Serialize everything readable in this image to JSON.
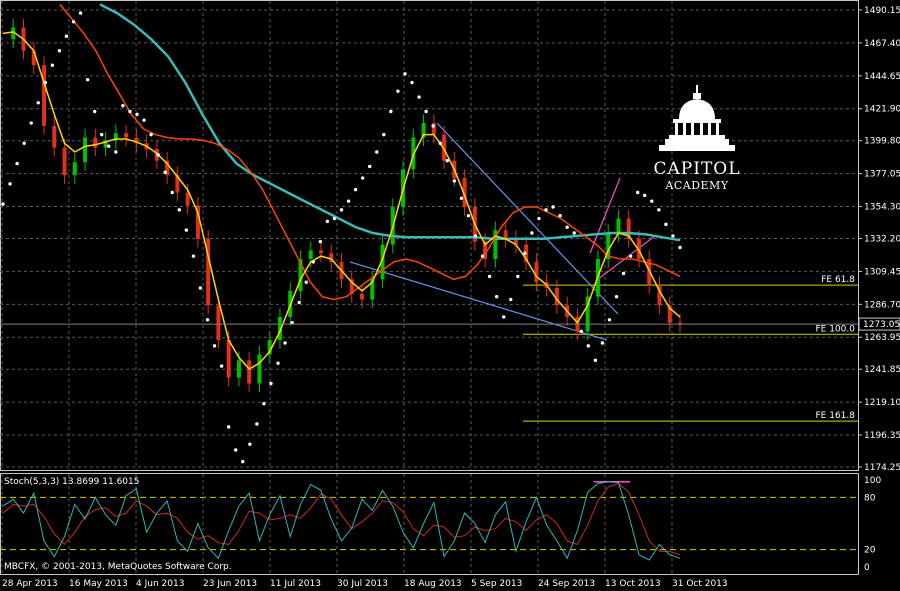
{
  "chart_data": {
    "type": "line",
    "price_panel": {
      "ylim": [
        1174.25,
        1490.15
      ],
      "y_ticks": [
        "1490.15",
        "1467.40",
        "1444.65",
        "1421.90",
        "1399.80",
        "1377.05",
        "1354.30",
        "1332.20",
        "1309.45",
        "1286.70",
        "1263.95",
        "1241.85",
        "1219.10",
        "1196.35",
        "1174.25"
      ],
      "current_price": "1273.05",
      "series": [
        {
          "role": "price_candles",
          "color": "#e0301e",
          "up_color": "#00c000",
          "values": [
            1470,
            1478,
            1462,
            1452,
            1410,
            1395,
            1376,
            1385,
            1402,
            1395,
            1400,
            1405,
            1402,
            1398,
            1394,
            1386,
            1376,
            1364,
            1355,
            1332,
            1286,
            1262,
            1236,
            1248,
            1232,
            1252,
            1262,
            1278,
            1296,
            1318,
            1324,
            1322,
            1316,
            1304,
            1294,
            1290,
            1304,
            1328,
            1354,
            1380,
            1402,
            1412,
            1404,
            1386,
            1374,
            1354,
            1330,
            1318,
            1338,
            1332,
            1328,
            1316,
            1302,
            1298,
            1286,
            1278,
            1268,
            1292,
            1318,
            1336,
            1346,
            1332,
            1318,
            1300,
            1286,
            1274,
            1273
          ]
        },
        {
          "role": "fast_ma",
          "color": "#ffd700",
          "values": [
            1474,
            1475,
            1470,
            1462,
            1440,
            1418,
            1398,
            1392,
            1396,
            1397,
            1399,
            1401,
            1401,
            1399,
            1396,
            1391,
            1384,
            1375,
            1366,
            1350,
            1320,
            1290,
            1262,
            1250,
            1242,
            1246,
            1254,
            1268,
            1286,
            1304,
            1316,
            1320,
            1318,
            1310,
            1302,
            1296,
            1302,
            1318,
            1340,
            1366,
            1390,
            1404,
            1404,
            1394,
            1380,
            1362,
            1342,
            1328,
            1334,
            1332,
            1328,
            1318,
            1306,
            1300,
            1290,
            1282,
            1274,
            1286,
            1306,
            1324,
            1336,
            1334,
            1324,
            1310,
            1296,
            1284,
            1278
          ]
        },
        {
          "role": "mid_ma",
          "color": "#ff4500",
          "values": [
            1494,
            1484,
            1474,
            1462,
            1446,
            1432,
            1418,
            1408,
            1404,
            1402,
            1401,
            1401,
            1400,
            1398,
            1394,
            1388,
            1378,
            1366,
            1350,
            1334,
            1318,
            1302,
            1292,
            1290,
            1292,
            1298,
            1304,
            1310,
            1316,
            1318,
            1316,
            1312,
            1308,
            1304,
            1306,
            1314,
            1326,
            1340,
            1350,
            1354,
            1354,
            1350,
            1346,
            1340,
            1334,
            1328,
            1320,
            1318,
            1318,
            1316,
            1314,
            1310,
            1306
          ]
        },
        {
          "role": "slow_ma",
          "color": "#3cb9b9",
          "values": [
            1494,
            1488,
            1480,
            1470,
            1458,
            1440,
            1418,
            1398,
            1384,
            1376,
            1370,
            1364,
            1358,
            1352,
            1346,
            1340,
            1336,
            1334,
            1333,
            1333,
            1333,
            1333,
            1333,
            1332,
            1332,
            1332,
            1332,
            1333,
            1334,
            1335,
            1336,
            1336,
            1335,
            1333,
            1331
          ]
        },
        {
          "role": "parabolic_sar",
          "color": "#ffffff",
          "values": [
            1356,
            1370,
            1384,
            1398,
            1412,
            1426,
            1440,
            1452,
            1462,
            1472,
            1482,
            1488,
            1442,
            1420,
            1404,
            1396,
            1392,
            1424,
            1420,
            1418,
            1414,
            1404,
            1390,
            1378,
            1364,
            1352,
            1338,
            1320,
            1298,
            1276,
            1258,
            1244,
            1202,
            1186,
            1178,
            1190,
            1204,
            1218,
            1232,
            1246,
            1260,
            1274,
            1288,
            1302,
            1316,
            1330,
            1344,
            1346,
            1352,
            1358,
            1366,
            1374,
            1382,
            1392,
            1404,
            1420,
            1434,
            1446,
            1440,
            1430,
            1420,
            1410,
            1398,
            1386,
            1372,
            1360,
            1348,
            1334,
            1320,
            1306,
            1292,
            1278,
            1290,
            1306,
            1322,
            1336,
            1346,
            1352,
            1354,
            1348,
            1340,
            1336,
            1268,
            1258,
            1248,
            1260,
            1276,
            1292,
            1308,
            1320,
            1364,
            1362,
            1358,
            1352,
            1342,
            1334,
            1326
          ]
        }
      ],
      "fibonacci_levels": [
        {
          "label": "FE 61.8",
          "value": 1300
        },
        {
          "label": "FE 100.0",
          "value": 1266
        },
        {
          "label": "FE 161.8",
          "value": 1206
        }
      ]
    },
    "stochastic_panel": {
      "label": "Stoch(5,3,3) 13.8699 11.6015",
      "ylim": [
        0,
        100
      ],
      "y_ticks": [
        "100",
        "80",
        "20",
        "0"
      ],
      "levels": [
        80,
        20
      ],
      "series": [
        {
          "role": "k",
          "color": "#2fb5b5",
          "values": [
            70,
            78,
            62,
            85,
            30,
            12,
            35,
            72,
            55,
            80,
            60,
            48,
            82,
            90,
            40,
            62,
            76,
            30,
            18,
            50,
            22,
            10,
            42,
            70,
            85,
            30,
            60,
            82,
            35,
            72,
            95,
            88,
            55,
            30,
            45,
            78,
            65,
            88,
            70,
            40,
            22,
            50,
            74,
            12,
            30,
            62,
            50,
            28,
            60,
            75,
            18,
            52,
            80,
            48,
            30,
            10,
            42,
            86,
            96,
            98,
            97,
            60,
            14,
            8,
            26,
            14,
            10
          ]
        },
        {
          "role": "d",
          "color": "#cc2a1e",
          "values": [
            62,
            72,
            70,
            72,
            58,
            38,
            26,
            40,
            58,
            66,
            68,
            58,
            62,
            76,
            70,
            60,
            62,
            56,
            40,
            32,
            36,
            28,
            26,
            42,
            64,
            62,
            54,
            56,
            60,
            56,
            68,
            84,
            78,
            60,
            44,
            52,
            62,
            76,
            74,
            64,
            44,
            36,
            48,
            46,
            34,
            36,
            46,
            42,
            44,
            56,
            52,
            42,
            54,
            60,
            50,
            30,
            26,
            48,
            76,
            92,
            96,
            86,
            60,
            30,
            18,
            18,
            14
          ]
        }
      ]
    },
    "x_tick_labels": [
      "28 Apr 2013",
      "16 May 2013",
      "4 Jun 2013",
      "23 Jun 2013",
      "11 Jul 2013",
      "30 Jul 2013",
      "18 Aug 2013",
      "5 Sep 2013",
      "24 Sep 2013",
      "13 Oct 2013",
      "31 Oct 2013"
    ],
    "copyright": "MBCFX, © 2001-2013, MetaQuotes Software Corp."
  },
  "logo": {
    "line1": "CAPITOL",
    "line2": "ACADEMY"
  },
  "colors": {
    "background": "#000000",
    "grid": "#5a5a5a",
    "fib": "#d2d200",
    "trendline": "#6495ed",
    "pink": "#ff4fc0",
    "axis_text": "#ffffff"
  }
}
